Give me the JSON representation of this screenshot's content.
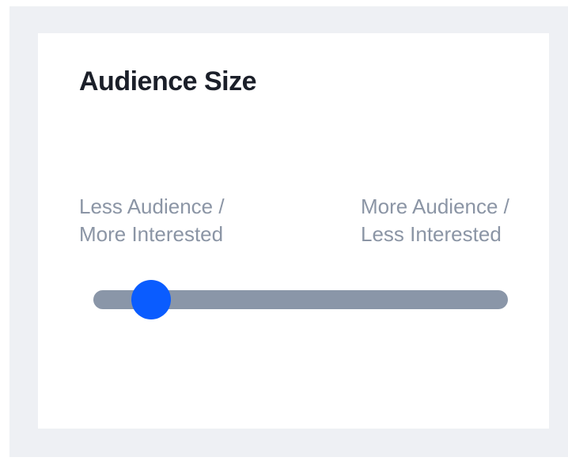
{
  "card": {
    "title": "Audience Size"
  },
  "slider": {
    "left_label_line1": "Less Audience /",
    "left_label_line2": "More Interested",
    "right_label_line1": "More Audience /",
    "right_label_line2": "Less Interested",
    "value_fraction": 0.14,
    "track_color": "#8a96a8",
    "thumb_color": "#0a5cff"
  }
}
